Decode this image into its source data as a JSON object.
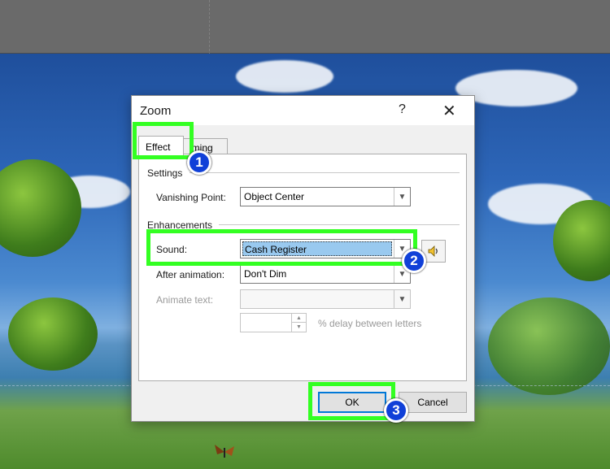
{
  "dialog": {
    "title": "Zoom",
    "help_glyph": "?",
    "close_glyph": "✕",
    "tabs": [
      {
        "label": "Effect",
        "active": true
      },
      {
        "label": "Timing",
        "visible_text": "iming",
        "active": false
      }
    ],
    "settings": {
      "group_label": "Settings",
      "vanishing_point_label": "Vanishing Point:",
      "vanishing_point_value": "Object Center"
    },
    "enhancements": {
      "group_label": "Enhancements",
      "sound_label": "Sound:",
      "sound_value": "Cash Register",
      "after_animation_label": "After animation:",
      "after_animation_value": "Don't Dim",
      "animate_text_label": "Animate text:",
      "animate_text_value": "",
      "delay_value": "",
      "delay_label": "% delay between letters"
    },
    "buttons": {
      "ok": "OK",
      "cancel": "Cancel"
    }
  },
  "annotations": {
    "badges": [
      "1",
      "2",
      "3"
    ],
    "highlight_color": "#33ff22",
    "badge_color": "#1040d8"
  },
  "icons": {
    "speaker": "speaker-icon",
    "dropdown": "chevron-down-icon"
  }
}
